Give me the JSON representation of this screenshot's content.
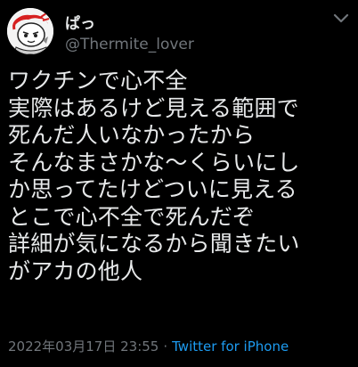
{
  "user": {
    "display_name": "ぱっ",
    "handle": "@Thermite_lover"
  },
  "tweet": {
    "text": "ワクチンで心不全\n実際はあるけど見える範囲で\n死んだ人いなかったから\nそんなまさかな〜くらいにし\nか思ってたけどついに見える\nとこで心不全で死んだぞ\n詳細が気になるから聞きたい\nがアカの他人",
    "datetime": "2022年03月17日 23:55",
    "separator": "·",
    "source": "Twitter for iPhone"
  },
  "icons": {
    "avatar": "avatar-illustration",
    "menu": "chevron-down-icon"
  },
  "colors": {
    "background": "#000000",
    "text": "#e7e9ea",
    "secondary": "#71767b",
    "link": "#1d9bf0"
  }
}
